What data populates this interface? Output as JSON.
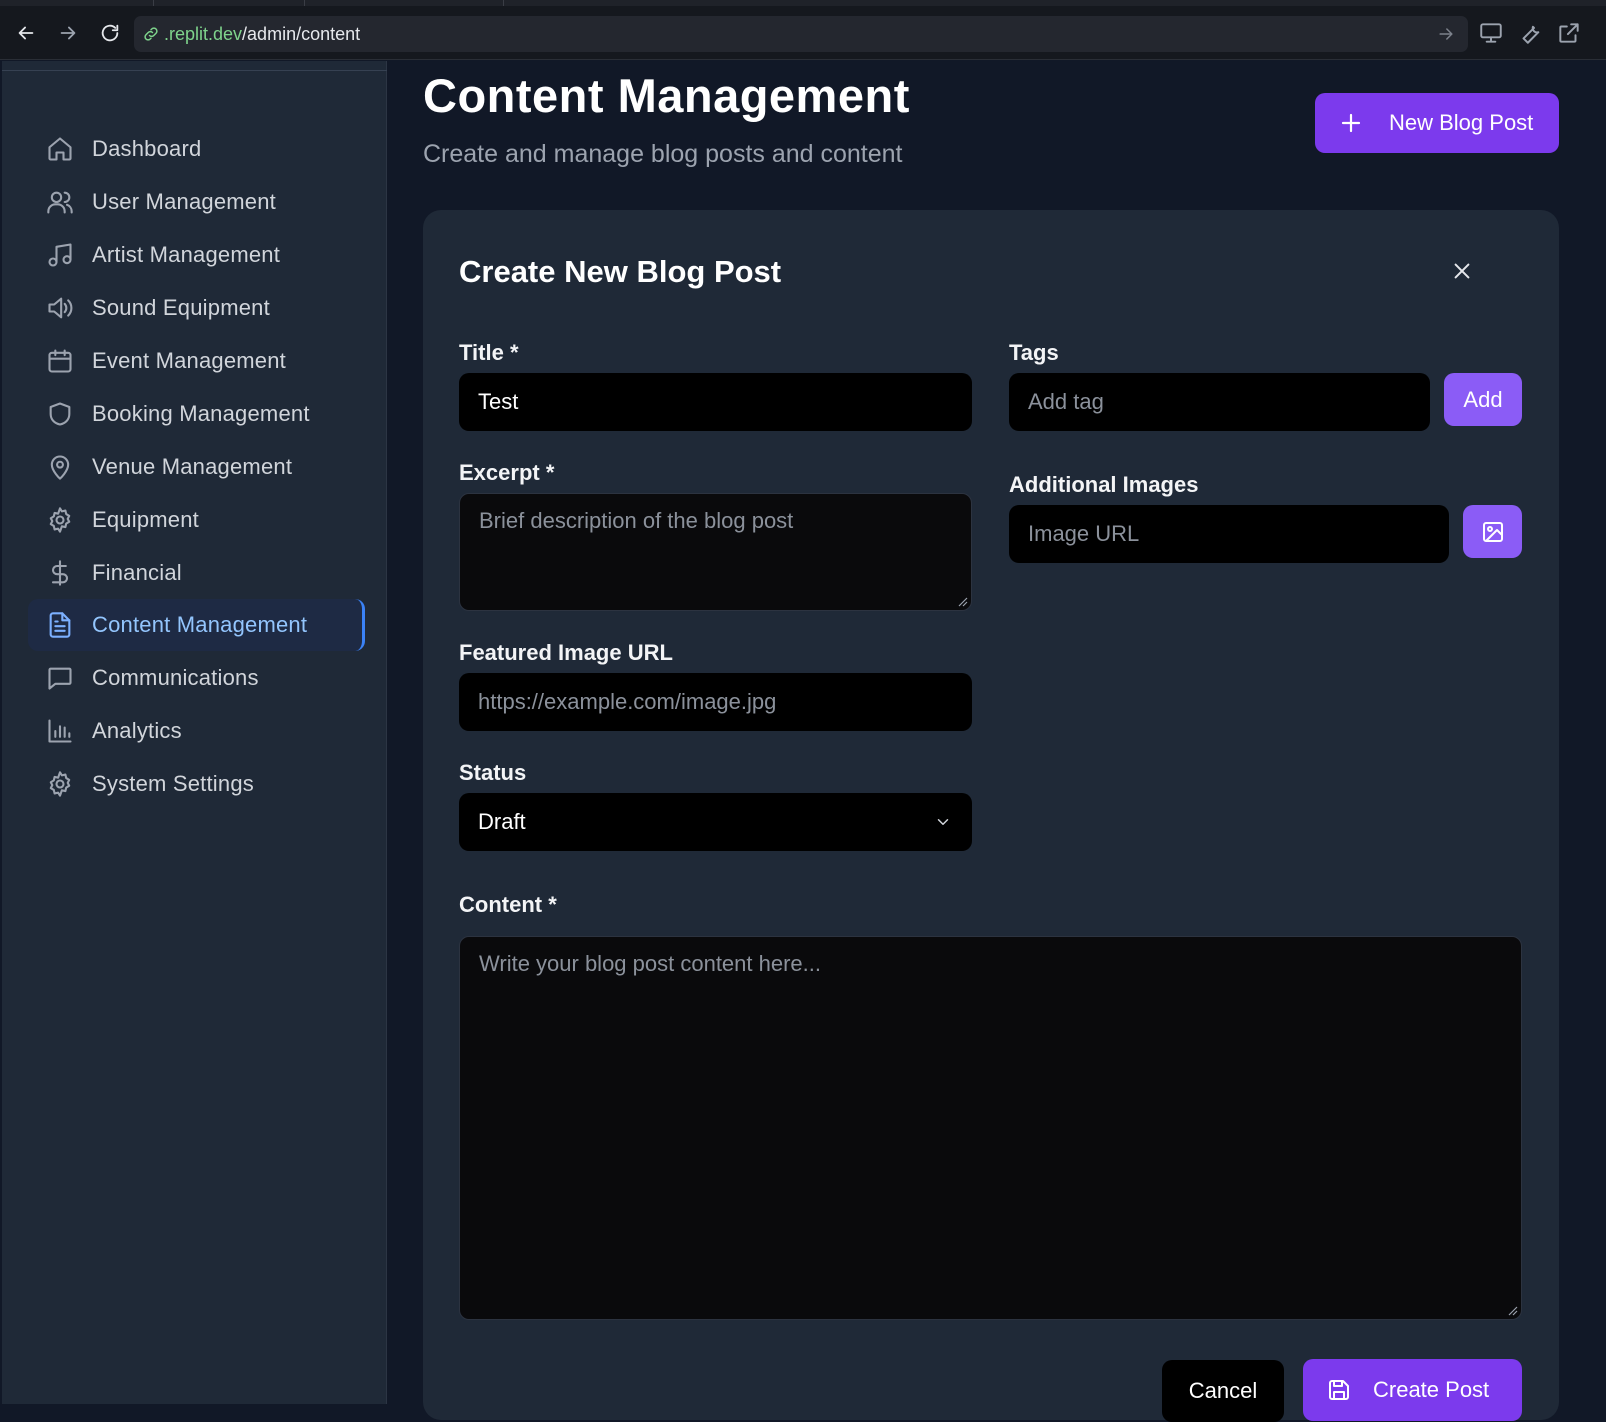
{
  "browser": {
    "url_domain": ".replit.dev",
    "url_path": "/admin/content"
  },
  "sidebar": {
    "items": [
      {
        "label": "Dashboard",
        "icon": "home-icon"
      },
      {
        "label": "User Management",
        "icon": "users-icon"
      },
      {
        "label": "Artist Management",
        "icon": "music-icon"
      },
      {
        "label": "Sound Equipment",
        "icon": "speaker-icon"
      },
      {
        "label": "Event Management",
        "icon": "calendar-icon"
      },
      {
        "label": "Booking Management",
        "icon": "shield-icon"
      },
      {
        "label": "Venue Management",
        "icon": "map-pin-icon"
      },
      {
        "label": "Equipment",
        "icon": "gear-icon"
      },
      {
        "label": "Financial",
        "icon": "dollar-icon"
      },
      {
        "label": "Content Management",
        "icon": "document-icon",
        "active": true
      },
      {
        "label": "Communications",
        "icon": "chat-icon"
      },
      {
        "label": "Analytics",
        "icon": "bar-chart-icon"
      },
      {
        "label": "System Settings",
        "icon": "gear-icon"
      }
    ]
  },
  "header": {
    "title": "Content Management",
    "subtitle": "Create and manage blog posts and content",
    "new_post_label": "New Blog Post"
  },
  "form": {
    "title": "Create New Blog Post",
    "title_label": "Title *",
    "title_value": "Test",
    "excerpt_label": "Excerpt *",
    "excerpt_placeholder": "Brief description of the blog post",
    "featured_label": "Featured Image URL",
    "featured_placeholder": "https://example.com/image.jpg",
    "status_label": "Status",
    "status_value": "Draft",
    "tags_label": "Tags",
    "tags_placeholder": "Add tag",
    "add_label": "Add",
    "images_label": "Additional Images",
    "images_placeholder": "Image URL",
    "content_label": "Content *",
    "content_placeholder": "Write your blog post content here...",
    "cancel_label": "Cancel",
    "create_label": "Create Post"
  },
  "colors": {
    "accent": "#7c3aed",
    "accent_light": "#8b5cf6",
    "active_nav": "#93c5fd",
    "background": "#111827",
    "panel": "#1f2937"
  }
}
